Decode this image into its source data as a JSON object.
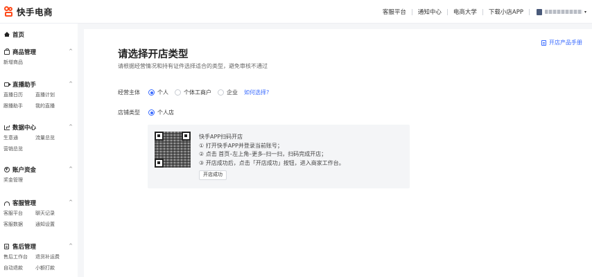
{
  "header": {
    "logo_text": "快手电商",
    "nav": [
      "客服平台",
      "通知中心",
      "电商大学",
      "下载小店APP"
    ],
    "user_caret": "▾"
  },
  "sidebar": {
    "home": "首页",
    "sections": [
      {
        "title": "商品管理",
        "icon": "box-icon",
        "links": [
          "新增商品"
        ]
      },
      {
        "title": "直播助手",
        "icon": "camera-icon",
        "links": [
          "直播日历",
          "直播计划",
          "跟播助手",
          "我的直播"
        ]
      },
      {
        "title": "数据中心",
        "icon": "chart-icon",
        "links": [
          "生意通",
          "流量总览",
          "营销总览"
        ]
      },
      {
        "title": "账户资金",
        "icon": "coin-icon",
        "links": [
          "奖金管理"
        ]
      },
      {
        "title": "客服管理",
        "icon": "headset-icon",
        "links": [
          "客服平台",
          "聊天记录",
          "客服数据",
          "通知设置"
        ]
      },
      {
        "title": "售后管理",
        "icon": "document-icon",
        "links": [
          "售后工作台",
          "退货补运费",
          "自动退款",
          "小额打款"
        ]
      }
    ],
    "caret": "^"
  },
  "main": {
    "manual_link": "开店产品手册",
    "title": "请选择开店类型",
    "subtitle": "请根据经营情况和持有证件选择适合的类型，避免审核不通过",
    "subject": {
      "label": "经营主体",
      "options": [
        {
          "label": "个人",
          "checked": true
        },
        {
          "label": "个体工商户",
          "checked": false
        },
        {
          "label": "企业",
          "checked": false
        }
      ],
      "help": "如何选择?"
    },
    "store_type": {
      "label": "店铺类型",
      "option": "个人店",
      "checked": true
    },
    "qr_panel": {
      "heading": "快手APP扫码开店",
      "steps": [
        "① 打开快手APP并登录当前账号；",
        "② 点击 首页–左上角–更多–扫一扫，扫码完成开店；",
        "③ 开店成功后，点击「开店成功」按钮，进入商家工作台。"
      ],
      "button": "开店成功"
    }
  },
  "colors": {
    "accent": "#3a6bff",
    "brand": "#fe4a1a"
  }
}
